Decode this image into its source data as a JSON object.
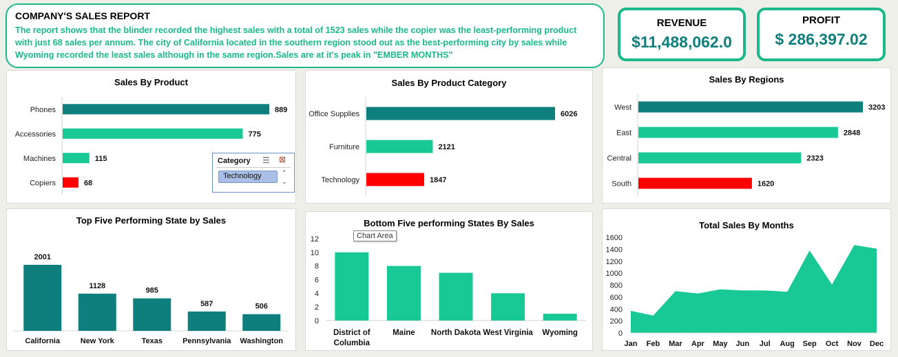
{
  "report": {
    "title": "COMPANY'S SALES REPORT",
    "text": "The report shows that the blinder recorded the highest sales with a total of 1523 sales while the copier was the least-performing product with just 68 sales per annum. The city of California located in the southern region stood out as the best-performing city by sales while Wyoming recorded the least sales although in the same region.Sales are at it's peak in \"EMBER MONTHS\""
  },
  "kpis": {
    "revenue_label": "REVENUE",
    "revenue_value": "$11,488,062.0",
    "profit_label": "PROFIT",
    "profit_value": "$ 286,397.02"
  },
  "colors": {
    "teal": "#0f7f7d",
    "green": "#18c995",
    "red": "#ff0000",
    "border": "#1bb88a"
  },
  "slicer": {
    "title": "Category",
    "selected": "Technology",
    "icons": [
      "multi-select-icon",
      "clear-filter-icon",
      "scroll-up-icon",
      "scroll-down-icon"
    ]
  },
  "tooltip": {
    "text": "Chart Area"
  },
  "chart_data": [
    {
      "id": "product",
      "type": "bar",
      "orientation": "horizontal",
      "title": "Sales By Product",
      "categories": [
        "Phones",
        "Accessories",
        "Machines",
        "Copiers"
      ],
      "values": [
        889,
        775,
        115,
        68
      ],
      "bar_colors": [
        "#0f7f7d",
        "#18c995",
        "#18c995",
        "#ff0000"
      ],
      "data_labels": true
    },
    {
      "id": "category",
      "type": "bar",
      "orientation": "horizontal",
      "title": "Sales By Product Category",
      "categories": [
        "Office Supplies",
        "Furniture",
        "Technology"
      ],
      "values": [
        6026,
        2121,
        1847
      ],
      "bar_colors": [
        "#0f7f7d",
        "#18c995",
        "#ff0000"
      ],
      "data_labels": true
    },
    {
      "id": "regions",
      "type": "bar",
      "orientation": "horizontal",
      "title": "Sales By Regions",
      "categories": [
        "West",
        "East",
        "Central",
        "South"
      ],
      "values": [
        3203,
        2848,
        2323,
        1620
      ],
      "bar_colors": [
        "#0f7f7d",
        "#18c995",
        "#18c995",
        "#ff0000"
      ],
      "data_labels": true
    },
    {
      "id": "top5",
      "type": "bar",
      "orientation": "vertical",
      "title": "Top Five Performing State by Sales",
      "categories": [
        "California",
        "New York",
        "Texas",
        "Pennsylvania",
        "Washington"
      ],
      "values": [
        2001,
        1128,
        985,
        587,
        506
      ],
      "bar_colors": [
        "#0f7f7d",
        "#0f7f7d",
        "#0f7f7d",
        "#0f7f7d",
        "#0f7f7d"
      ],
      "data_labels": true
    },
    {
      "id": "bottom5",
      "type": "bar",
      "orientation": "vertical",
      "title": "Bottom Five performing States By Sales",
      "categories": [
        [
          "District of",
          "Columbia"
        ],
        [
          "Maine"
        ],
        [
          "North Dakota"
        ],
        [
          "West Virginia"
        ],
        [
          "Wyoming"
        ]
      ],
      "values": [
        10,
        8,
        7,
        4,
        1
      ],
      "ylim": [
        0,
        12
      ],
      "yticks": [
        0,
        2,
        4,
        6,
        8,
        10,
        12
      ],
      "bar_colors": [
        "#18c995",
        "#18c995",
        "#18c995",
        "#18c995",
        "#18c995"
      ],
      "data_labels": false
    },
    {
      "id": "months",
      "type": "area",
      "title": "Total Sales By Months",
      "categories": [
        "Jan",
        "Feb",
        "Mar",
        "Apr",
        "May",
        "Jun",
        "Jul",
        "Aug",
        "Sep",
        "Oct",
        "Nov",
        "Dec"
      ],
      "values": [
        370,
        290,
        700,
        660,
        730,
        710,
        710,
        690,
        1380,
        810,
        1470,
        1410
      ],
      "ylim": [
        0,
        1600
      ],
      "yticks": [
        0,
        200,
        400,
        600,
        800,
        1000,
        1200,
        1400,
        1600
      ],
      "color": "#18c995"
    }
  ]
}
